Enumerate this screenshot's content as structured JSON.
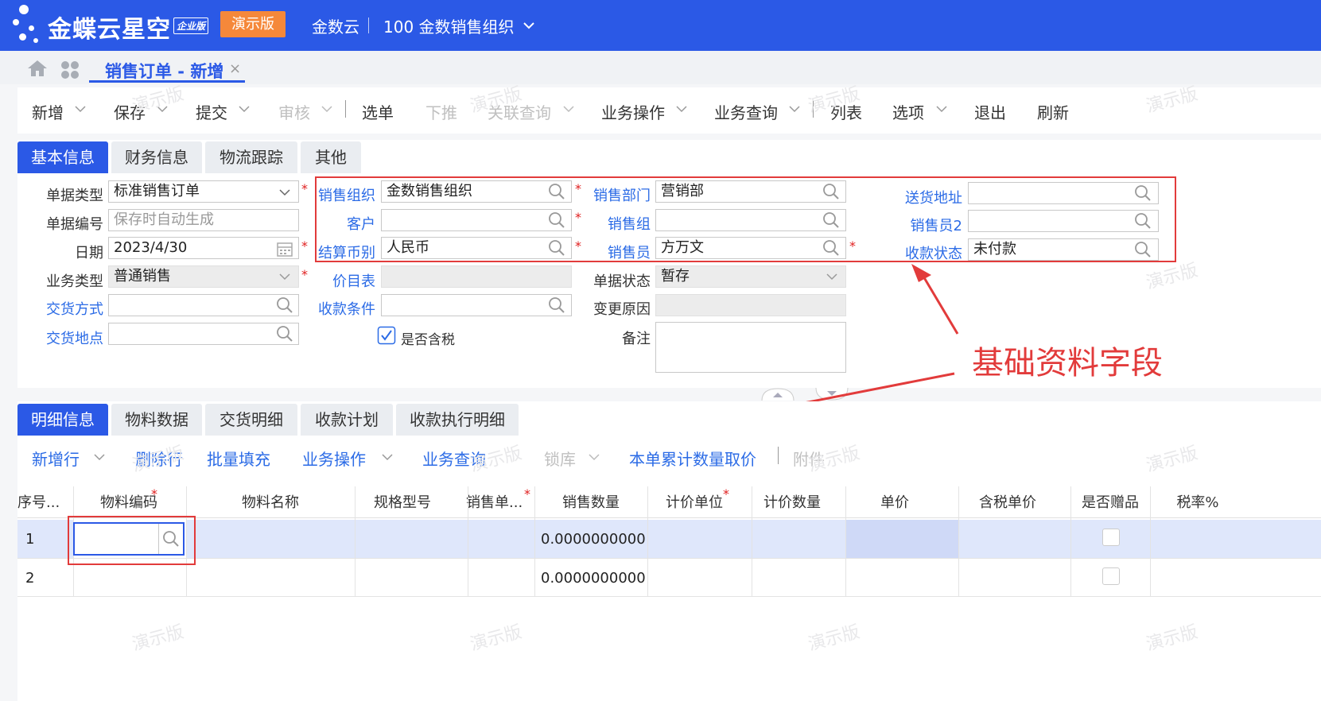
{
  "header": {
    "brand": "金蝶云星空",
    "brand_badge": "企业版",
    "demo_label": "演示版",
    "org_name": "金数云",
    "org_entity": "100 金数销售组织"
  },
  "page_tab": {
    "label": "销售订单 - 新增",
    "close": "×"
  },
  "toolbar": {
    "items": [
      "新增",
      "保存",
      "提交",
      "审核",
      "选单",
      "下推",
      "关联查询",
      "业务操作",
      "业务查询",
      "列表",
      "选项",
      "退出",
      "刷新"
    ]
  },
  "info_tabs": [
    "基本信息",
    "财务信息",
    "物流跟踪",
    "其他"
  ],
  "form": {
    "bill_type": {
      "label": "单据类型",
      "value": "标准销售订单"
    },
    "bill_no": {
      "label": "单据编号",
      "placeholder": "保存时自动生成"
    },
    "date": {
      "label": "日期",
      "value": "2023/4/30"
    },
    "biz_type": {
      "label": "业务类型",
      "value": "普通销售"
    },
    "delivery_method": {
      "label": "交货方式",
      "value": ""
    },
    "delivery_place": {
      "label": "交货地点",
      "value": ""
    },
    "sale_org": {
      "label": "销售组织",
      "value": "金数销售组织"
    },
    "customer": {
      "label": "客户",
      "value": ""
    },
    "currency": {
      "label": "结算币别",
      "value": "人民币"
    },
    "price_list": {
      "label": "价目表",
      "value": ""
    },
    "pay_terms": {
      "label": "收款条件",
      "value": ""
    },
    "tax_included": {
      "label": "是否含税",
      "checked": true
    },
    "sale_dept": {
      "label": "销售部门",
      "value": "营销部"
    },
    "sale_group": {
      "label": "销售组",
      "value": ""
    },
    "salesman": {
      "label": "销售员",
      "value": "方万文"
    },
    "bill_status": {
      "label": "单据状态",
      "value": "暂存"
    },
    "change_reason": {
      "label": "变更原因",
      "value": ""
    },
    "remark": {
      "label": "备注",
      "value": ""
    },
    "ship_address": {
      "label": "送货地址",
      "value": ""
    },
    "salesman2": {
      "label": "销售员2",
      "value": ""
    },
    "receipt_status": {
      "label": "收款状态",
      "value": "未付款"
    }
  },
  "annotation": {
    "text": "基础资料字段"
  },
  "detail_tabs": [
    "明细信息",
    "物料数据",
    "交货明细",
    "收款计划",
    "收款执行明细"
  ],
  "detail_toolbar": [
    "新增行",
    "删除行",
    "批量填充",
    "业务操作",
    "业务查询",
    "锁库",
    "本单累计数量取价",
    "附件"
  ],
  "grid": {
    "columns": [
      "序号...",
      "物料编码",
      "物料名称",
      "规格型号",
      "销售单...",
      "销售数量",
      "计价单位",
      "计价数量",
      "单价",
      "含税单价",
      "是否赠品",
      "税率%"
    ],
    "rows": [
      {
        "seq": "1",
        "qty": "0.0000000000"
      },
      {
        "seq": "2",
        "qty": "0.0000000000"
      }
    ]
  },
  "watermark": "演示版",
  "colors": {
    "primary": "#2b59e6",
    "accent_orange": "#f5883a",
    "annotation_red": "#e23b3b",
    "link": "#2b6be6"
  }
}
